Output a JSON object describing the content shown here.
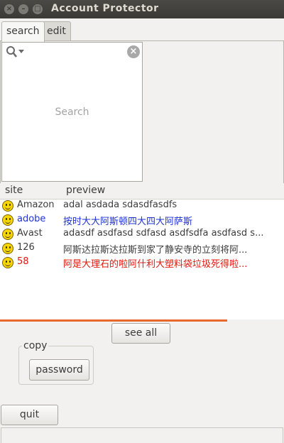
{
  "window": {
    "title": "Account Protector"
  },
  "tabs": [
    {
      "label": "search"
    },
    {
      "label": "edit"
    }
  ],
  "search": {
    "placeholder": "Search"
  },
  "table": {
    "columns": [
      "site",
      "preview"
    ],
    "rows": [
      {
        "site": "Amazon",
        "preview": "adal asdada sdasdfasdfs",
        "color": "#3c3c3c"
      },
      {
        "site": "adobe",
        "preview": "按时大大阿斯顿四大四大阿萨斯",
        "color": "#1f33d6"
      },
      {
        "site": "Avast",
        "preview": "adasdf asdfasd sdfasd asdfsdfa asdfasd s...",
        "color": "#3c3c3c"
      },
      {
        "site": "126",
        "preview": "阿斯达拉斯达拉斯到家了静安寺的立刻将阿...",
        "color": "#3c3c3c"
      },
      {
        "site": "58",
        "preview": "阿是大理石的啦阿什利大塑料袋垃圾死得啦...",
        "color": "#e0180e"
      }
    ]
  },
  "buttons": {
    "see_all": "see all",
    "password": "password",
    "quit": "quit"
  },
  "copy_group": {
    "label": "copy"
  },
  "progress": {
    "fraction": 0.8
  },
  "colors": {
    "accent": "#e9692c",
    "icon": "smiley-icon"
  }
}
